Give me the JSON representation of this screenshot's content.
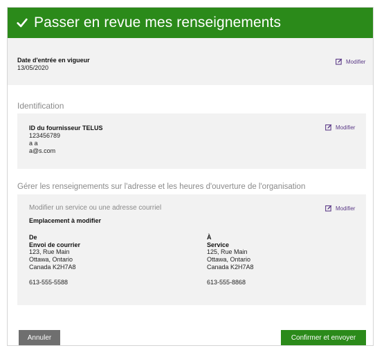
{
  "header": {
    "title": "Passer en revue mes renseignements",
    "icon": "check-icon",
    "color": "#2b8a1a"
  },
  "effective_date": {
    "label": "Date d'entrée en vigueur",
    "value": "13/05/2020",
    "modify_label": "Modifier"
  },
  "identification": {
    "heading": "Identification",
    "supplier_id_label": "ID du fournisseur TELUS",
    "supplier_id_value": "123456789",
    "name": "a a",
    "email": "a@s.com",
    "modify_label": "Modifier"
  },
  "address": {
    "heading": "Gérer les renseignements sur l'adresse et les heures d'ouverture de l'organisation",
    "subheading": "Modifier un service ou une adresse courriel",
    "location_label": "Emplacement à modifier",
    "modify_label": "Modifier",
    "from": {
      "label": "De",
      "type": "Envoi de courrier",
      "street": "123, Rue Main",
      "city": "Ottawa, Ontario",
      "country_postal": "Canada K2H7A8",
      "phone": "613-555-5588"
    },
    "to": {
      "label": "À",
      "type": "Service",
      "street": "125, Rue Main",
      "city": "Ottawa, Ontario",
      "country_postal": "Canada K2H7A8",
      "phone": "613-555-8868"
    }
  },
  "footer": {
    "cancel_label": "Annuler",
    "confirm_label": "Confirmer et envoyer"
  },
  "colors": {
    "accent_green": "#2b8a1a",
    "link_purple": "#5b3a87",
    "card_gray": "#f2f2f2",
    "cancel_gray": "#6f6f6f"
  }
}
